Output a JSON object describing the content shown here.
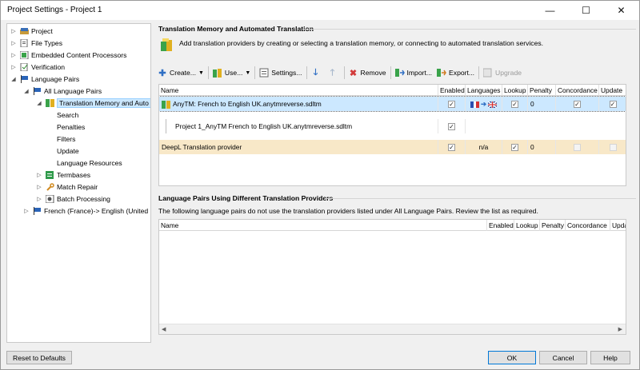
{
  "window": {
    "title": "Project Settings - Project 1",
    "min": "—",
    "max": "☐",
    "close": "✕"
  },
  "tree": {
    "items": [
      {
        "label": "Project",
        "icon": "project-icon"
      },
      {
        "label": "File Types",
        "icon": "file-types-icon"
      },
      {
        "label": "Embedded Content Processors",
        "icon": "embedded-content-icon"
      },
      {
        "label": "Verification",
        "icon": "verification-icon"
      },
      {
        "label": "Language Pairs",
        "icon": "flag-icon"
      },
      {
        "label": "All Language Pairs",
        "icon": "flag-icon"
      },
      {
        "label": "Translation Memory and Auto",
        "icon": "translation-memory-icon"
      },
      {
        "label": "Search"
      },
      {
        "label": "Penalties"
      },
      {
        "label": "Filters"
      },
      {
        "label": "Update"
      },
      {
        "label": "Language Resources"
      },
      {
        "label": "Termbases",
        "icon": "termbase-icon"
      },
      {
        "label": "Match Repair",
        "icon": "wrench-icon"
      },
      {
        "label": "Batch Processing",
        "icon": "batch-processing-icon"
      },
      {
        "label": "French (France)-> English (United",
        "icon": "flag-icon"
      }
    ]
  },
  "tm_group": {
    "title": "Translation Memory and Automated Translation",
    "info": "Add translation providers by creating or selecting a translation memory, or connecting to automated translation services."
  },
  "toolbar": {
    "create": "Create...",
    "use": "Use...",
    "settings": "Settings...",
    "remove": "Remove",
    "import": "Import...",
    "export": "Export...",
    "upgrade": "Upgrade"
  },
  "tm_grid": {
    "columns": [
      "Name",
      "Enabled",
      "Languages",
      "Lookup",
      "Penalty",
      "Concordance",
      "Update"
    ],
    "rows": [
      {
        "name": "AnyTM: French to English UK.anytmreverse.sdltm",
        "enabled": true,
        "languages": "",
        "lookup": true,
        "penalty": "0",
        "concordance": true,
        "update": true
      },
      {
        "name": "Project 1_AnyTM  French to English UK.anytmreverse.sdltm",
        "enabled": true
      },
      {
        "name": "DeepL Translation provider",
        "enabled": true,
        "languages": "n/a",
        "lookup": true,
        "penalty": "0",
        "concordance": false,
        "update": false
      }
    ]
  },
  "lp_group": {
    "title": "Language Pairs Using Different Translation Providers",
    "info": "The following language pairs do not use the translation providers listed under All Language Pairs. Review the list as required."
  },
  "lp_grid": {
    "columns": [
      "Name",
      "Enabled",
      "Lookup",
      "Penalty",
      "Concordance",
      "Upda"
    ]
  },
  "buttons": {
    "reset": "Reset to Defaults",
    "ok": "OK",
    "cancel": "Cancel",
    "help": "Help"
  },
  "colors": {
    "selected_row": "#cce8ff",
    "highlight_row": "#f8e8c8",
    "accent": "#0078d7"
  }
}
